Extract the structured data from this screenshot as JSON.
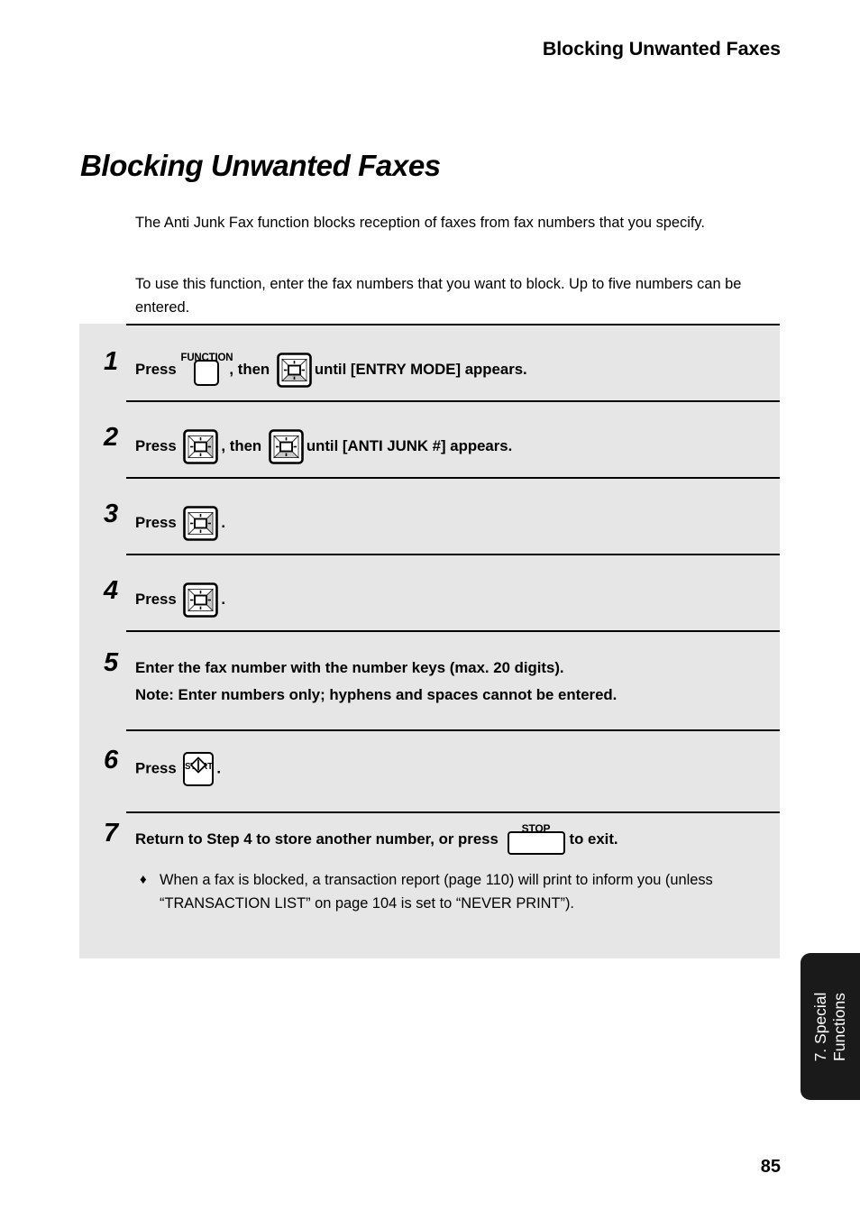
{
  "header": {
    "running_title": "Blocking Unwanted Faxes"
  },
  "title": "Blocking Unwanted Faxes",
  "intro": {
    "paragraph_1": "The Anti Junk Fax function blocks reception of faxes from fax numbers that you specify.",
    "paragraph_2": "To use this function, enter the fax numbers that you want to block. Up to five numbers can be entered."
  },
  "procedure": {
    "steps": [
      {
        "number": "1",
        "text_before": "Press",
        "icon_1": "function-key-icon",
        "icon_1_label": "FUNCTION",
        "text_middle": ", then",
        "icon_2": "nav-key-down-icon",
        "text_after": "until [ENTRY MODE] appears."
      },
      {
        "number": "2",
        "text_before": "Press",
        "icon_1": "nav-key-right-icon",
        "text_middle": ", then",
        "icon_2": "nav-key-down-icon",
        "text_after": "until [ANTI JUNK #] appears."
      },
      {
        "number": "3",
        "text_before": "Press",
        "icon_1": "nav-key-right-icon",
        "text_after": "."
      },
      {
        "number": "4",
        "text_before": "Press",
        "icon_1": "nav-key-right-icon",
        "text_after": "."
      },
      {
        "number": "5",
        "line_1": "Enter the fax number with the number keys (max. 20 digits).",
        "line_2": "Note: Enter numbers only; hyphens and spaces cannot be entered."
      },
      {
        "number": "6",
        "text_before": "Press",
        "icon_1": "start-key-icon",
        "icon_1_label": "START",
        "text_after": "."
      },
      {
        "number": "7",
        "text_before": "Return to Step 4 to store another number, or press",
        "icon_1": "stop-key-icon",
        "icon_1_label": "STOP",
        "text_after": "to exit."
      }
    ],
    "bullet_marker": "♦",
    "bullet_text": "When a fax is blocked, a transaction report (page 110) will print to inform you (unless “TRANSACTION LIST” on page 104 is set to “NEVER PRINT”)."
  },
  "side_tab": {
    "line_1": "7. Special",
    "line_2": "Functions"
  },
  "page_number": "85",
  "colors": {
    "procedure_box_bg": "#e6e6e6",
    "side_tab_bg": "#1a1a1a",
    "key_highlight": "#c9c9c9",
    "rule": "#000000"
  }
}
